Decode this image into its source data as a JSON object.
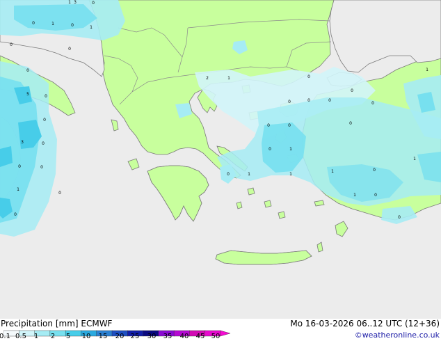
{
  "map": {
    "colors": {
      "sea": "#ececec",
      "land": "#c8ff9d",
      "border": "#8c8c8c",
      "coast": "#7a7a7a"
    },
    "values": [
      "3",
      "0",
      "0",
      "1",
      "0",
      "1",
      "0",
      "0",
      "0",
      "0",
      "5",
      "0",
      "0",
      "0",
      "3",
      "0",
      "1",
      "0",
      "0",
      "2",
      "1",
      "0",
      "0",
      "0",
      "0",
      "0",
      "0",
      "0",
      "0",
      "1",
      "0",
      "1",
      "1",
      "1",
      "0",
      "1",
      "0",
      "0",
      "1",
      "1",
      "0",
      "0",
      "1"
    ]
  },
  "footer": {
    "title": "Precipitation [mm]  ECMWF",
    "validity": "Mo 16-03-2026 06..12 UTC (12+36)",
    "credit": "©weatheronline.co.uk",
    "scale": {
      "labels": [
        "0.1",
        "0.5",
        "1",
        "2",
        "5",
        "10",
        "15",
        "20",
        "25",
        "30",
        "35",
        "40",
        "45",
        "50"
      ],
      "colors": [
        "#f5fafc",
        "#d2f5fa",
        "#a6ecf4",
        "#77e0ef",
        "#47cde9",
        "#2aa9df",
        "#2a80d2",
        "#1e4fc1",
        "#121ea8",
        "#0a0a80",
        "#8a0ad2",
        "#b40ad2",
        "#d20ab4",
        "#e60acd",
        "#f50ad2"
      ]
    }
  }
}
